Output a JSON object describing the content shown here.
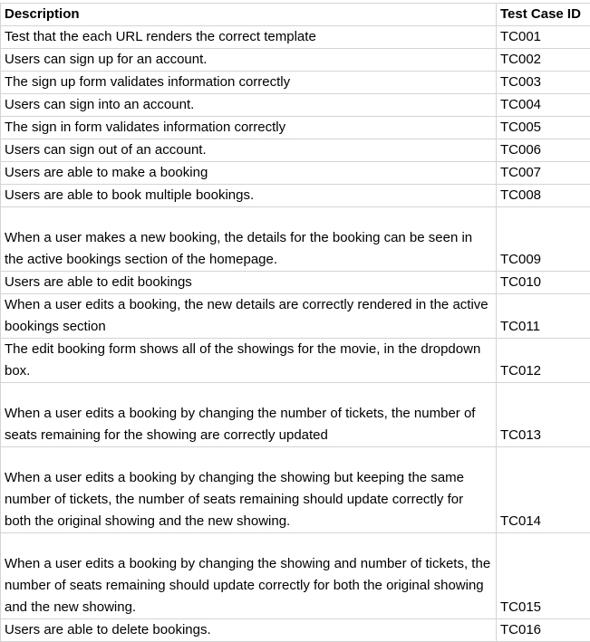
{
  "table": {
    "headers": [
      "Description",
      "Test Case ID"
    ],
    "rows": [
      {
        "description": "Test that the each URL renders the correct template",
        "id": "TC001"
      },
      {
        "description": "Users can sign up for an account.",
        "id": "TC002"
      },
      {
        "description": "The sign up form validates information correctly",
        "id": "TC003"
      },
      {
        "description": "Users can sign into an account.",
        "id": "TC004"
      },
      {
        "description": "The sign in form validates information correctly",
        "id": "TC005"
      },
      {
        "description": "Users can sign out of an account.",
        "id": "TC006"
      },
      {
        "description": "Users are able to make a booking",
        "id": "TC007"
      },
      {
        "description": "Users are able to book multiple bookings.",
        "id": "TC008"
      },
      {
        "description": "When a user makes a new booking, the details for the booking can be seen in the active bookings section of the homepage.",
        "id": "TC009"
      },
      {
        "description": "Users are able to edit bookings",
        "id": "TC010"
      },
      {
        "description": "When a user edits a booking, the new details are correctly rendered in the active bookings section",
        "id": "TC011"
      },
      {
        "description": "The edit booking form shows all of the showings for the movie, in the dropdown box.",
        "id": "TC012"
      },
      {
        "description": "When a user edits a booking by changing the number of tickets, the number of seats remaining for the showing are correctly updated",
        "id": "TC013"
      },
      {
        "description": "When a user edits a booking by changing the showing but keeping the same number of tickets, the number of seats remaining should update correctly for both the original showing and the new showing.",
        "id": "TC014"
      },
      {
        "description": "When a user edits a booking by changing the showing and number of tickets, the number of seats remaining should update correctly for both the original showing and the new showing.",
        "id": "TC015"
      },
      {
        "description": "Users are able to delete bookings.",
        "id": "TC016"
      }
    ]
  }
}
